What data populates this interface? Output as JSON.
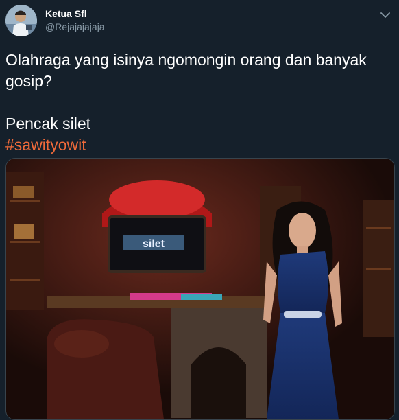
{
  "user": {
    "display_name": "Ketua Sfl",
    "handle": "@Rejajajajaja"
  },
  "tweet": {
    "line1": "Olahraga yang isinya ngomongin orang dan banyak gosip?",
    "line2": "Pencak silet",
    "hashtag": "#sawityowit"
  },
  "media": {
    "tv_screen_text": "silet"
  },
  "icons": {
    "more": "chevron-down-icon"
  },
  "colors": {
    "background": "#15202b",
    "hashtag": "#ef6a3a",
    "secondary_text": "#8899a6"
  }
}
